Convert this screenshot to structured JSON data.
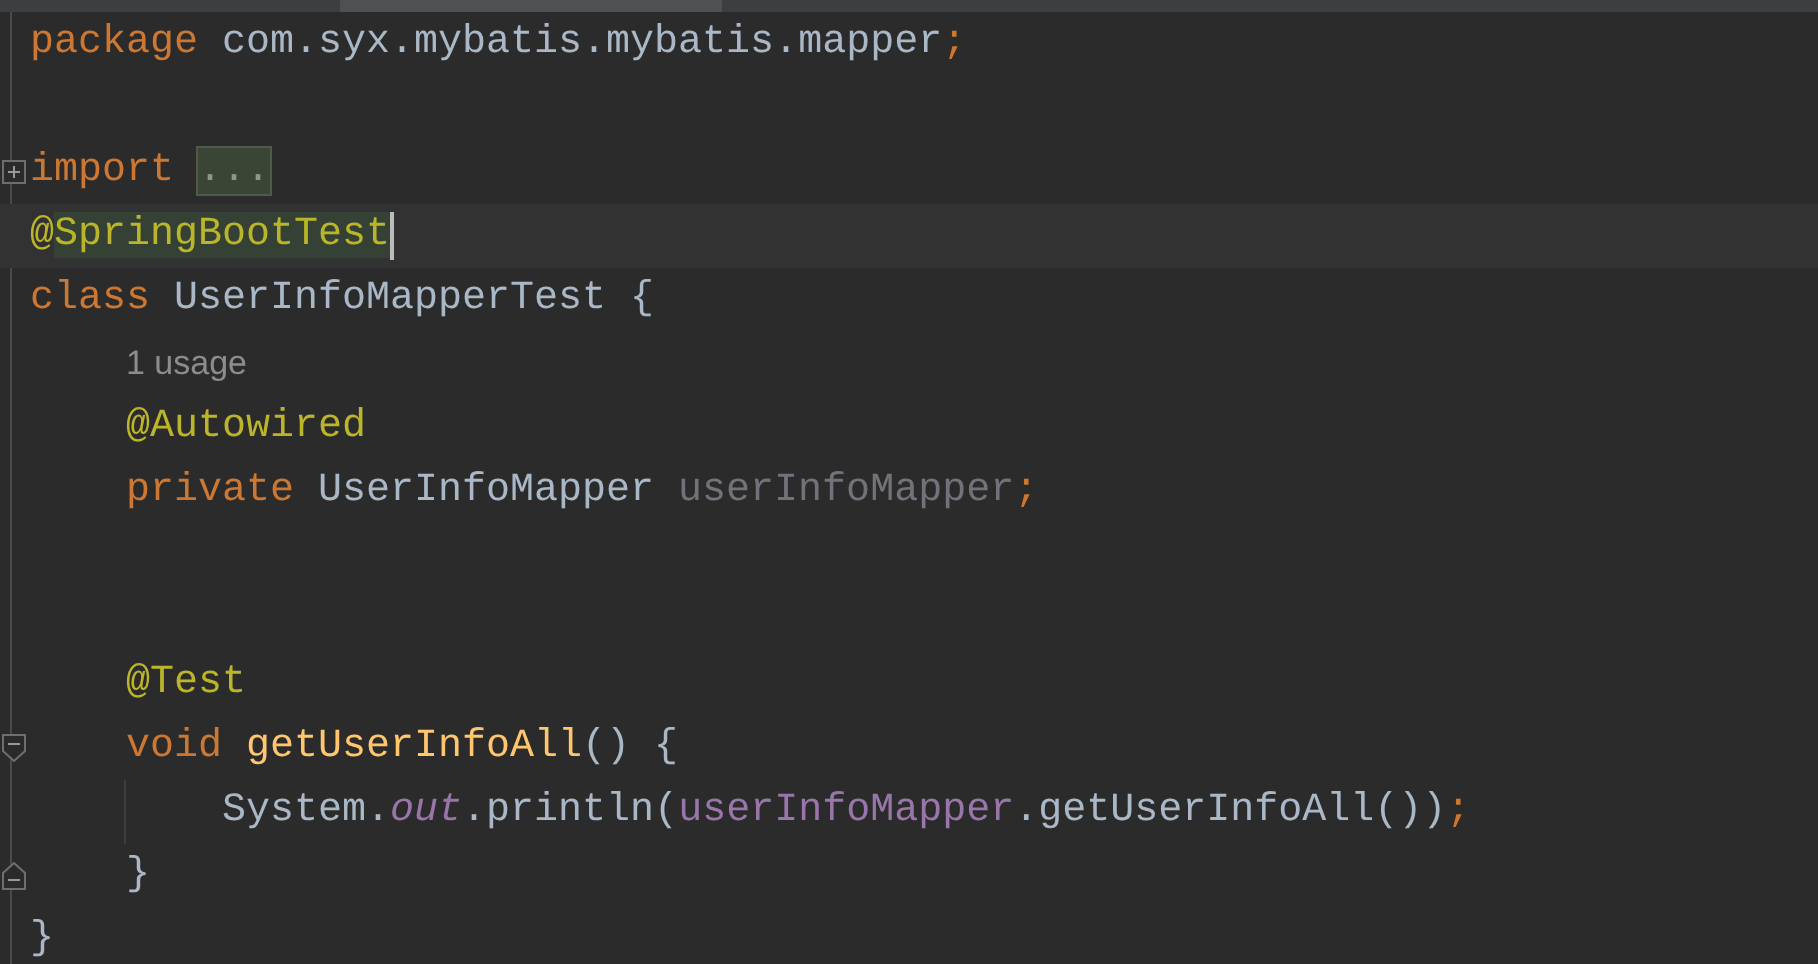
{
  "editor": {
    "lines": [
      {
        "kind": "code",
        "current": false,
        "tokens": [
          {
            "kind": "keyword",
            "text": "package "
          },
          {
            "kind": "plain",
            "text": "com.syx.mybatis.mybatis.mapper"
          },
          {
            "kind": "punct",
            "text": ";"
          }
        ]
      },
      {
        "kind": "blank",
        "current": false
      },
      {
        "kind": "folded-import",
        "current": false,
        "tokens": [
          {
            "kind": "keyword",
            "text": "import "
          },
          {
            "kind": "folded",
            "text": "..."
          }
        ]
      },
      {
        "kind": "code",
        "current": true,
        "tokens": [
          {
            "kind": "annotation",
            "text": "@"
          },
          {
            "kind": "annotation-highlighted",
            "text": "SpringBootTest"
          }
        ]
      },
      {
        "kind": "code",
        "current": false,
        "tokens": [
          {
            "kind": "keyword",
            "text": "class "
          },
          {
            "kind": "plain",
            "text": "UserInfoMapperTest {"
          }
        ],
        "children": [
          {
            "kind": "hint",
            "current": false,
            "tokens": [
              {
                "kind": "hint",
                "text": "1 usage"
              }
            ]
          },
          {
            "kind": "code",
            "current": false,
            "tokens": [
              {
                "kind": "annotation",
                "text": "@Autowired"
              }
            ]
          },
          {
            "kind": "code",
            "current": false,
            "tokens": [
              {
                "kind": "keyword",
                "text": "private "
              },
              {
                "kind": "plain",
                "text": "UserInfoMapper "
              },
              {
                "kind": "unused",
                "text": "userInfoMapper"
              },
              {
                "kind": "punct",
                "text": ";"
              }
            ]
          },
          {
            "kind": "blank",
            "current": false
          },
          {
            "kind": "blank",
            "current": false
          },
          {
            "kind": "code",
            "current": false,
            "tokens": [
              {
                "kind": "annotation",
                "text": "@Test"
              }
            ]
          },
          {
            "kind": "block-start",
            "current": false,
            "tokens": [
              {
                "kind": "keyword",
                "text": "void "
              },
              {
                "kind": "method",
                "text": "getUserInfoAll"
              },
              {
                "kind": "plain",
                "text": "() {"
              }
            ],
            "children": [
              {
                "kind": "code",
                "current": false,
                "tokens": [
                  {
                    "kind": "plain",
                    "text": "System."
                  },
                  {
                    "kind": "static",
                    "text": "out"
                  },
                  {
                    "kind": "plain",
                    "text": ".println("
                  },
                  {
                    "kind": "field",
                    "text": "userInfoMapper"
                  },
                  {
                    "kind": "plain",
                    "text": ".getUserInfoAll())"
                  },
                  {
                    "kind": "punct",
                    "text": ";"
                  }
                ]
              }
            ]
          },
          {
            "kind": "block-end",
            "current": false,
            "tokens": [
              {
                "kind": "plain",
                "text": "}"
              }
            ]
          }
        ]
      },
      {
        "kind": "code",
        "current": false,
        "tokens": [
          {
            "kind": "plain",
            "text": "}"
          }
        ]
      }
    ]
  }
}
